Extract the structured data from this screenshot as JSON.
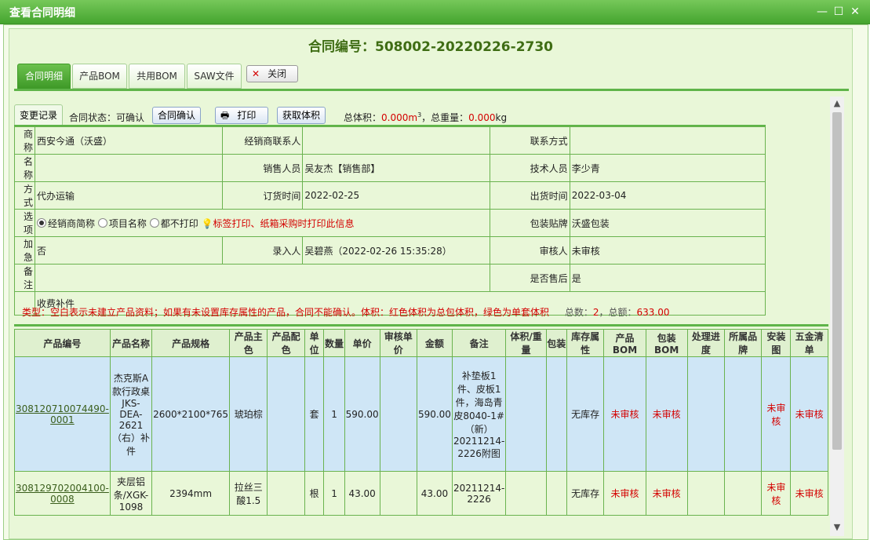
{
  "window": {
    "title": "查看合同明细",
    "min": "—",
    "max": "☐",
    "close": "✕"
  },
  "contract": {
    "title": "合同编号：508002-20220226-2730"
  },
  "tabs": [
    "合同明细",
    "产品BOM",
    "共用BOM",
    "SAW文件"
  ],
  "close_button": "关闭",
  "toolbar": {
    "change_log": "变更记录",
    "status_label": "合同状态：",
    "status_value": "可确认",
    "confirm": "合同确认",
    "print": "打印",
    "get_volume": "获取体积",
    "volume_label": "总体积：",
    "volume_value": "0.000m",
    "volume_sup": "3",
    "weight_label": "，总重量：",
    "weight_value": "0.000",
    "weight_unit": "kg"
  },
  "info": {
    "r1": {
      "l1": "商称",
      "v1": "西安今通（沃盛）",
      "l2": "经销商联系人",
      "v2": "",
      "l3": "联系方式",
      "v3": ""
    },
    "r2": {
      "l1": "名称",
      "v1": "",
      "l2": "销售人员",
      "v2": "吴友杰【销售部】",
      "l3": "技术人员",
      "v3": "李少青"
    },
    "r3": {
      "l1": "方式",
      "v1": "代办运输",
      "l2": "订货时间",
      "v2": "2022-02-25",
      "l3": "出货时间",
      "v3": "2022-03-04"
    },
    "r4": {
      "l1": "选项",
      "opt1": "经销商简称",
      "opt2": "项目名称",
      "opt3": "都不打印",
      "hint": "标签打印、纸箱采购时打印此信息",
      "l3": "包装贴牌",
      "v3": "沃盛包装"
    },
    "r5": {
      "l1": "加急",
      "v1": "否",
      "l2": "录入人",
      "v2": "吴碧燕（2022-02-26 15:35:28）",
      "l3": "审核人",
      "v3": "未审核"
    },
    "r6": {
      "l1": "备注",
      "v1": "",
      "l3": "是否售后",
      "v3": "是"
    },
    "r7": {
      "v1": "收费补件"
    }
  },
  "notes": {
    "type_note": "类型：空白表示未建立产品资料；如果有未设置库存属性的产品，合同不能确认。体积：红色体积为总包体积，绿色为单套体积",
    "total_label": "总数：",
    "total_value": "2",
    "sum_label": "，总额：",
    "sum_value": "633.00"
  },
  "grid": {
    "headers": [
      "产品编号",
      "产品名称",
      "产品规格",
      "产品主色",
      "产品配色",
      "单位",
      "数量",
      "单价",
      "审核单价",
      "金额",
      "备注",
      "体积/重量",
      "包装",
      "库存属性",
      "产品BOM",
      "包装BOM",
      "处理进度",
      "所属品牌",
      "安装图",
      "五金清单"
    ],
    "rows": [
      {
        "code": "308120710074490-0001",
        "name": "杰克斯A款行政桌JKS-DEA-2621（右）补件",
        "spec": "2600*2100*765",
        "color": "琥珀棕",
        "color2": "",
        "unit": "套",
        "qty": "1",
        "price": "590.00",
        "aprice": "",
        "amount": "590.00",
        "remark": "补垫板1件、皮板1件，海岛青皮8040-1#（新）20211214-2226附图",
        "vol": "",
        "pack": "",
        "stock": "无库存",
        "bom": "未审核",
        "pbom": "未审核",
        "progress": "",
        "brand": "",
        "install": "未审核",
        "hardware": "未审核"
      },
      {
        "code": "308129702004100-0008",
        "name": "夹层铝条/XGK-1098",
        "spec": "2394mm",
        "color": "拉丝三酸1.5",
        "color2": "",
        "unit": "根",
        "qty": "1",
        "price": "43.00",
        "aprice": "",
        "amount": "43.00",
        "remark": "20211214-2226",
        "vol": "",
        "pack": "",
        "stock": "无库存",
        "bom": "未审核",
        "pbom": "未审核",
        "progress": "",
        "brand": "",
        "install": "未审核",
        "hardware": "未审核"
      }
    ]
  }
}
